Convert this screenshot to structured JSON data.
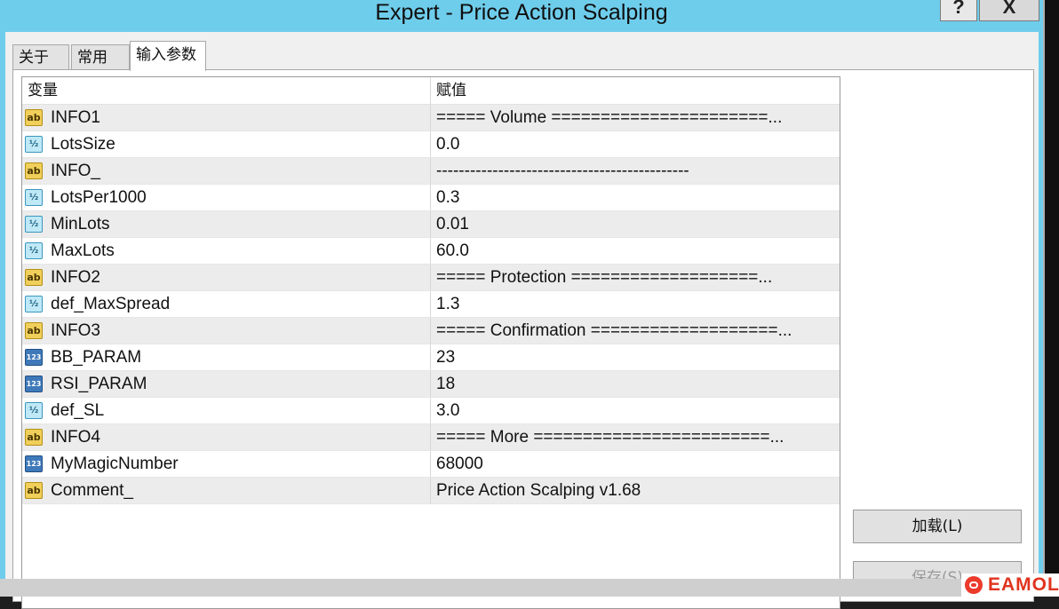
{
  "window": {
    "title": "Expert - Price Action Scalping",
    "help_label": "?",
    "close_label": "X"
  },
  "tabs": [
    {
      "label": "关于"
    },
    {
      "label": "常用"
    },
    {
      "label": "输入参数",
      "active": true
    }
  ],
  "grid": {
    "col_variable": "变量",
    "col_value": "赋值",
    "rows": [
      {
        "type": "ab",
        "icon": "string-icon",
        "name": "INFO1",
        "value": "===== Volume ======================..."
      },
      {
        "type": "half",
        "icon": "double-icon",
        "name": "LotsSize",
        "value": "0.0"
      },
      {
        "type": "ab",
        "icon": "string-icon",
        "name": "INFO_",
        "value": "---------------------------------------------"
      },
      {
        "type": "half",
        "icon": "double-icon",
        "name": "LotsPer1000",
        "value": "0.3"
      },
      {
        "type": "half",
        "icon": "double-icon",
        "name": "MinLots",
        "value": "0.01"
      },
      {
        "type": "half",
        "icon": "double-icon",
        "name": "MaxLots",
        "value": "60.0"
      },
      {
        "type": "ab",
        "icon": "string-icon",
        "name": "INFO2",
        "value": "===== Protection ===================..."
      },
      {
        "type": "half",
        "icon": "double-icon",
        "name": "def_MaxSpread",
        "value": "1.3"
      },
      {
        "type": "ab",
        "icon": "string-icon",
        "name": "INFO3",
        "value": "===== Confirmation ===================..."
      },
      {
        "type": "num",
        "icon": "integer-icon",
        "name": "BB_PARAM",
        "value": "23"
      },
      {
        "type": "num",
        "icon": "integer-icon",
        "name": "RSI_PARAM",
        "value": "18"
      },
      {
        "type": "half",
        "icon": "double-icon",
        "name": "def_SL",
        "value": "3.0"
      },
      {
        "type": "ab",
        "icon": "string-icon",
        "name": "INFO4",
        "value": "===== More ========================..."
      },
      {
        "type": "num",
        "icon": "integer-icon",
        "name": "MyMagicNumber",
        "value": "68000"
      },
      {
        "type": "ab",
        "icon": "string-icon",
        "name": "Comment_",
        "value": "Price Action Scalping v1.68"
      }
    ]
  },
  "icon_glyphs": {
    "ab": "ab",
    "half": "½",
    "num": "123"
  },
  "buttons": {
    "load_label": "加载(L)",
    "save_label": "保存(S)"
  },
  "watermark": {
    "text": "EAMOL"
  }
}
